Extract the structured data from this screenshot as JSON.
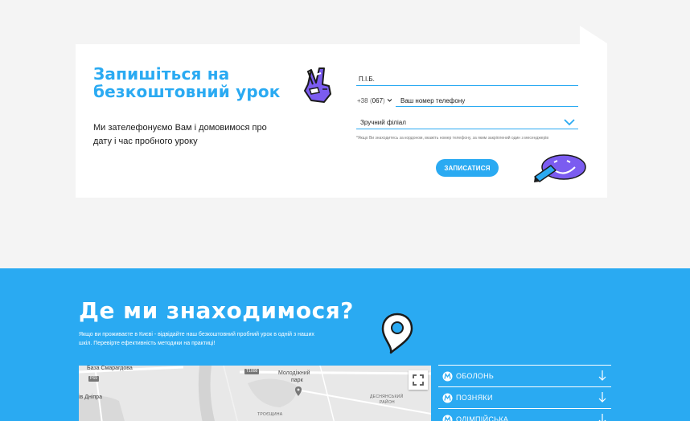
{
  "signup": {
    "title_line1": "Запишіться на",
    "title_line2": "безкоштовний урок",
    "description": "Ми зателефонуємо Вам і домовимося про дату і час пробного уроку",
    "name_placeholder": "П.І.Б.",
    "phone_code": "+38",
    "phone_operator": "067",
    "phone_placeholder": "Ваш номер телефону",
    "branch_label": "Зручний філіал",
    "hint": "*Якщо Ви знаходитесь за кордоном, вкажіть номер телефону, за яким закріплений один з месенджерів",
    "submit_label": "ЗАПИСАТИСЯ"
  },
  "location": {
    "title": "Де ми знаходимося?",
    "description": "Якщо ви проживаєте в Києві - відвідайте наш безкоштовний пробний урок в одній з наших шкіл. Перевірте ефективність методики на практиці!"
  },
  "map": {
    "labels": {
      "emerald_base": "База Смарагдова",
      "dnipro": "ів Дніпра",
      "young_park_1": "Молодіжний",
      "young_park_2": "парк",
      "desnianskyi_1": "ДЕСНЯНСЬКИЙ",
      "desnianskyi_2": "РАЙОН",
      "troieshchyna": "ТРОЄЩИНА",
      "road_t1008": "Т1008",
      "road_p69": "Р69"
    }
  },
  "metro": {
    "items": [
      {
        "name": "ОБОЛОНЬ"
      },
      {
        "name": "ПОЗНЯКИ"
      },
      {
        "name": "ОЛІМПІЙСЬКА"
      }
    ]
  },
  "colors": {
    "accent": "#2aaaf2",
    "purple": "#7b5cf0",
    "background": "#f4f4f4"
  }
}
